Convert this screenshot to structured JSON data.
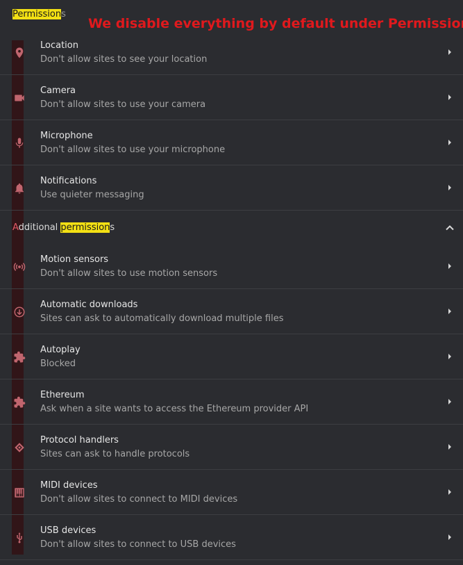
{
  "header": {
    "section_title_highlight": "Permission",
    "section_title_rest": "s",
    "annotation": "We disable everything by default under Permissions"
  },
  "permissions": [
    {
      "icon": "location-pin-icon",
      "title": "Location",
      "subtitle": "Don't allow sites to see your location"
    },
    {
      "icon": "camera-icon",
      "title": "Camera",
      "subtitle": "Don't allow sites to use your camera"
    },
    {
      "icon": "microphone-icon",
      "title": "Microphone",
      "subtitle": "Don't allow sites to use your microphone"
    },
    {
      "icon": "bell-icon",
      "title": "Notifications",
      "subtitle": "Use quieter messaging"
    }
  ],
  "additional": {
    "label_first": "A",
    "label_middle": "dditional ",
    "label_highlight": "permission",
    "label_rest": "s",
    "expanded": true
  },
  "additional_permissions": [
    {
      "icon": "motion-sensor-icon",
      "title": "Motion sensors",
      "subtitle": "Don't allow sites to use motion sensors"
    },
    {
      "icon": "download-icon",
      "title": "Automatic downloads",
      "subtitle": "Sites can ask to automatically download multiple files"
    },
    {
      "icon": "puzzle-icon",
      "title": "Autoplay",
      "subtitle": "Blocked"
    },
    {
      "icon": "puzzle-icon",
      "title": "Ethereum",
      "subtitle": "Ask when a site wants to access the Ethereum provider API"
    },
    {
      "icon": "protocol-handler-icon",
      "title": "Protocol handlers",
      "subtitle": "Sites can ask to handle protocols"
    },
    {
      "icon": "midi-piano-icon",
      "title": "MIDI devices",
      "subtitle": "Don't allow sites to connect to MIDI devices"
    },
    {
      "icon": "usb-icon",
      "title": "USB devices",
      "subtitle": "Don't allow sites to connect to USB devices"
    }
  ],
  "colors": {
    "background": "#2b2c30",
    "highlight": "#f3e014",
    "annotation": "#e0191d",
    "icon": "#c0656e"
  }
}
